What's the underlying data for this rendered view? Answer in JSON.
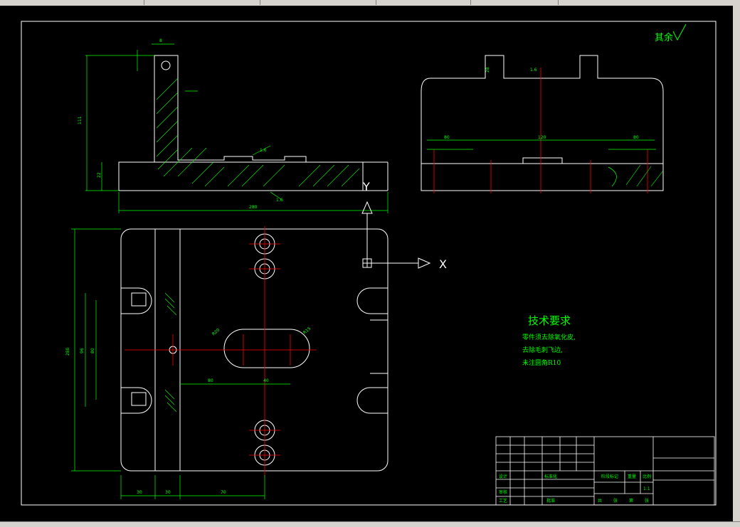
{
  "note_top_right": "其余",
  "surface_finish_symbol": "surface-finish-check-icon",
  "tech": {
    "title": "技术要求",
    "lines": [
      "零件须去除氧化皮,",
      "去除毛刺飞边,",
      "未注圆角R10"
    ]
  },
  "axes": {
    "x_label": "X",
    "y_label": "Y"
  },
  "dims_front": {
    "overall_width": "280",
    "height": "111",
    "base_height": "22",
    "top_gap": "8",
    "ra_a": "1.6",
    "ra_b": "1.6"
  },
  "dims_side": {
    "width_a": "80",
    "width_b": "120",
    "width_c": "80",
    "slot": "28",
    "ra": "1.6"
  },
  "dims_plan": {
    "height": "280",
    "inner_a": "96",
    "inner_b": "80",
    "offset_a": "80",
    "offset_b": "40",
    "w1": "30",
    "w2": "30",
    "w3": "70",
    "r1": "R20",
    "r2": "R15"
  },
  "title_block": {
    "label_design": "设计",
    "label_std": "标准化",
    "label_check": "审核",
    "label_process": "工艺",
    "label_approve": "批准",
    "label_stage": "阶段标记",
    "label_weight": "重量",
    "label_scale": "比例",
    "scale_value": "1:1",
    "label_sheets": "共",
    "label_sheet": "张",
    "label_of": "第",
    "label_sheet2": "张"
  }
}
